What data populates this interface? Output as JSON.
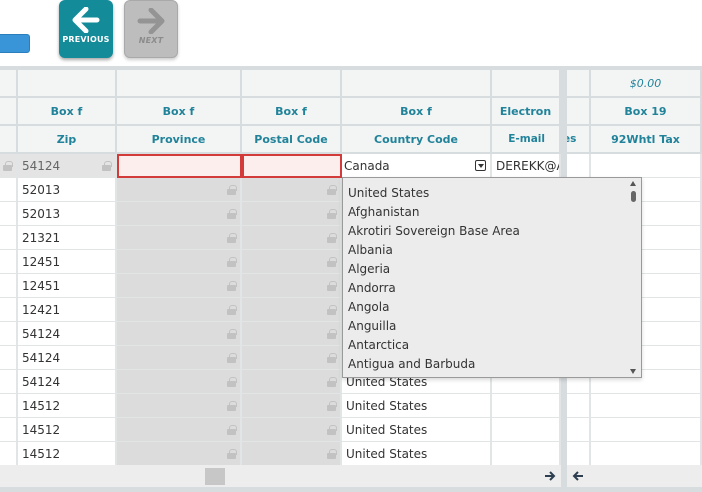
{
  "toolbar": {
    "previous_label": "PREVIOUS",
    "next_label": "NEXT"
  },
  "grid": {
    "money_row": [
      "",
      "",
      "",
      "",
      "",
      "",
      "",
      "$0.00"
    ],
    "header_top": [
      "",
      "Box f",
      "Box f",
      "Box f",
      "Box f",
      "Electron",
      "",
      "Box 19"
    ],
    "header_bottom": [
      "",
      "Zip",
      "Province",
      "Postal Code",
      "Country Code",
      "E-mail",
      "es",
      "92Whtl Tax"
    ],
    "edit_row": {
      "zip": "54124",
      "country": "Canada",
      "email": "DEREKK@A"
    },
    "rows": [
      {
        "zip": "52013",
        "country": ""
      },
      {
        "zip": "52013",
        "country": ""
      },
      {
        "zip": "21321",
        "country": ""
      },
      {
        "zip": "12451",
        "country": ""
      },
      {
        "zip": "12451",
        "country": ""
      },
      {
        "zip": "12421",
        "country": ""
      },
      {
        "zip": "54124",
        "country": ""
      },
      {
        "zip": "54124",
        "country": ""
      },
      {
        "zip": "54124",
        "country": "United States"
      },
      {
        "zip": "14512",
        "country": "United States"
      },
      {
        "zip": "14512",
        "country": "United States"
      },
      {
        "zip": "14512",
        "country": "United States"
      }
    ]
  },
  "dropdown": {
    "options": [
      "United States",
      "Afghanistan",
      "Akrotiri Sovereign Base Area",
      "Albania",
      "Algeria",
      "Andorra",
      "Angola",
      "Anguilla",
      "Antarctica",
      "Antigua and Barbuda"
    ]
  },
  "icons": {
    "previous": "arrow-left-icon",
    "next": "arrow-right-icon",
    "lock": "lock-icon",
    "scroll_right": "arrow-right-icon",
    "scroll_left": "arrow-left-icon"
  },
  "colors": {
    "accent": "#138b99",
    "header_text": "#20839a",
    "error_border": "#d33b3b"
  }
}
